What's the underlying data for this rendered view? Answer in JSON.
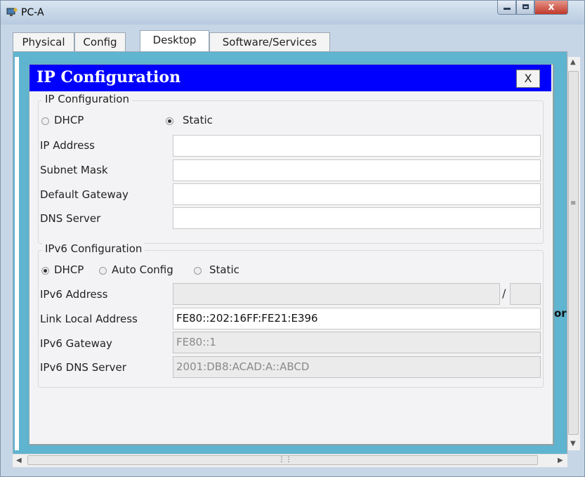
{
  "window": {
    "title": "PC-A",
    "close_glyph": "x"
  },
  "tabs": [
    {
      "label": "Physical"
    },
    {
      "label": "Config"
    },
    {
      "label": "Desktop"
    },
    {
      "label": "Software/Services"
    }
  ],
  "active_tab": "Desktop",
  "dialog": {
    "title": "IP Configuration",
    "close_label": "X",
    "ipv4": {
      "group_label": "IP Configuration",
      "dhcp_label": "DHCP",
      "static_label": "Static",
      "selected_mode": "Static",
      "fields": [
        {
          "label": "IP Address",
          "value": ""
        },
        {
          "label": "Subnet Mask",
          "value": ""
        },
        {
          "label": "Default Gateway",
          "value": ""
        },
        {
          "label": "DNS Server",
          "value": ""
        }
      ]
    },
    "ipv6": {
      "group_label": "IPv6 Configuration",
      "dhcp_label": "DHCP",
      "auto_label": "Auto Config",
      "static_label": "Static",
      "selected_mode": "DHCP",
      "address_label": "IPv6 Address",
      "address_value": "",
      "prefix_separator": "/",
      "prefix_value": "",
      "link_local_label": "Link Local Address",
      "link_local_value": "FE80::202:16FF:FE21:E396",
      "gateway_label": "IPv6 Gateway",
      "gateway_value": "FE80::1",
      "dns_label": "IPv6 DNS Server",
      "dns_value": "2001:DB8:ACAD:A::ABCD"
    }
  },
  "background_text": "or",
  "colors": {
    "dialog_title_bg": "#0000ff",
    "desktop_bg": "#5fb4cf"
  },
  "icons": [
    "app-icon",
    "minimize-icon",
    "maximize-icon",
    "close-icon",
    "scroll-up-arrow-icon",
    "scroll-down-arrow-icon",
    "scroll-left-arrow-icon",
    "scroll-right-arrow-icon",
    "scroll-grip-icon"
  ]
}
